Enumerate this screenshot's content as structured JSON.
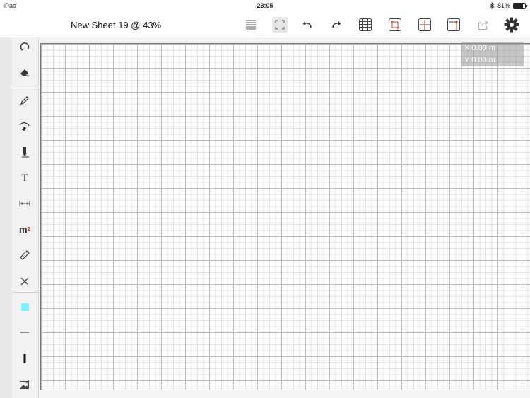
{
  "statusbar": {
    "device": "iPad",
    "time": "23:05",
    "battery_percent": "81%",
    "battery_level": 0.81
  },
  "toolbar": {
    "title": "New Sheet 19 @ 43%",
    "icons": [
      "list-icon",
      "fit-screen-icon",
      "undo-icon",
      "redo-icon",
      "grid-icon",
      "frame-icon",
      "crosshair-icon",
      "marker-icon",
      "share-icon",
      "gear-icon"
    ]
  },
  "coordinates": {
    "x": "X 0.00 m",
    "y": "Y 0.00 m"
  },
  "sidebar": {
    "tools": [
      "rotate-icon",
      "eraser-icon",
      "pencil-icon",
      "curve-pen-icon",
      "marker-pen-icon",
      "text-tool-icon",
      "dimension-icon",
      "area-m2-icon",
      "ruler-icon",
      "close-icon",
      "fill-color-swatch",
      "line-thin-icon",
      "line-thick-icon",
      "image-icon"
    ],
    "text_tool": "T",
    "area_unit": "m",
    "area_superscript": "2",
    "fill_color": "#7ff2ff"
  }
}
